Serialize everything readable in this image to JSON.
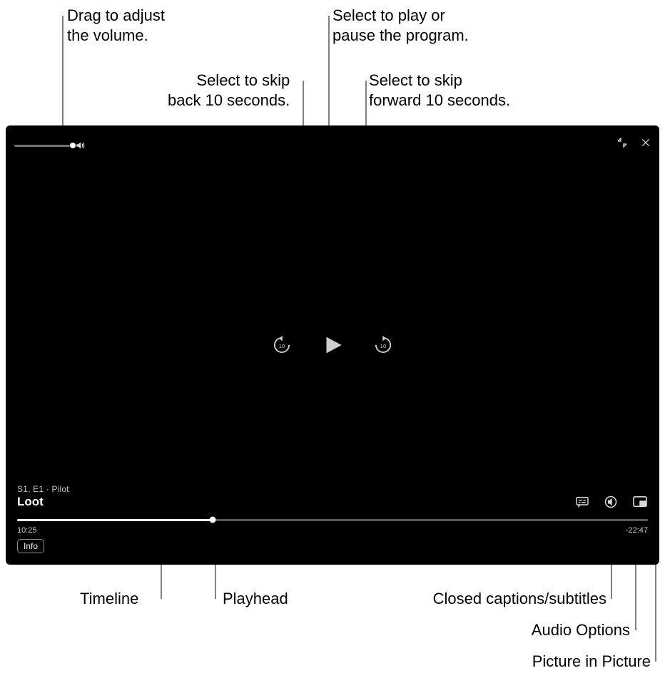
{
  "callouts": {
    "volume": "Drag to adjust\nthe volume.",
    "skip_back": "Select to skip\nback 10 seconds.",
    "play_pause": "Select to play or\npause the program.",
    "skip_fwd": "Select to skip\nforward 10 seconds.",
    "timeline": "Timeline",
    "playhead": "Playhead",
    "cc": "Closed captions/subtitles",
    "audio": "Audio Options",
    "pip": "Picture in Picture"
  },
  "player": {
    "episode_meta": "S1, E1 · Pilot",
    "title": "Loot",
    "elapsed": "10:25",
    "remaining": "-22:47",
    "info_label": "Info",
    "skip_value": "10",
    "progress_percent": 31
  }
}
